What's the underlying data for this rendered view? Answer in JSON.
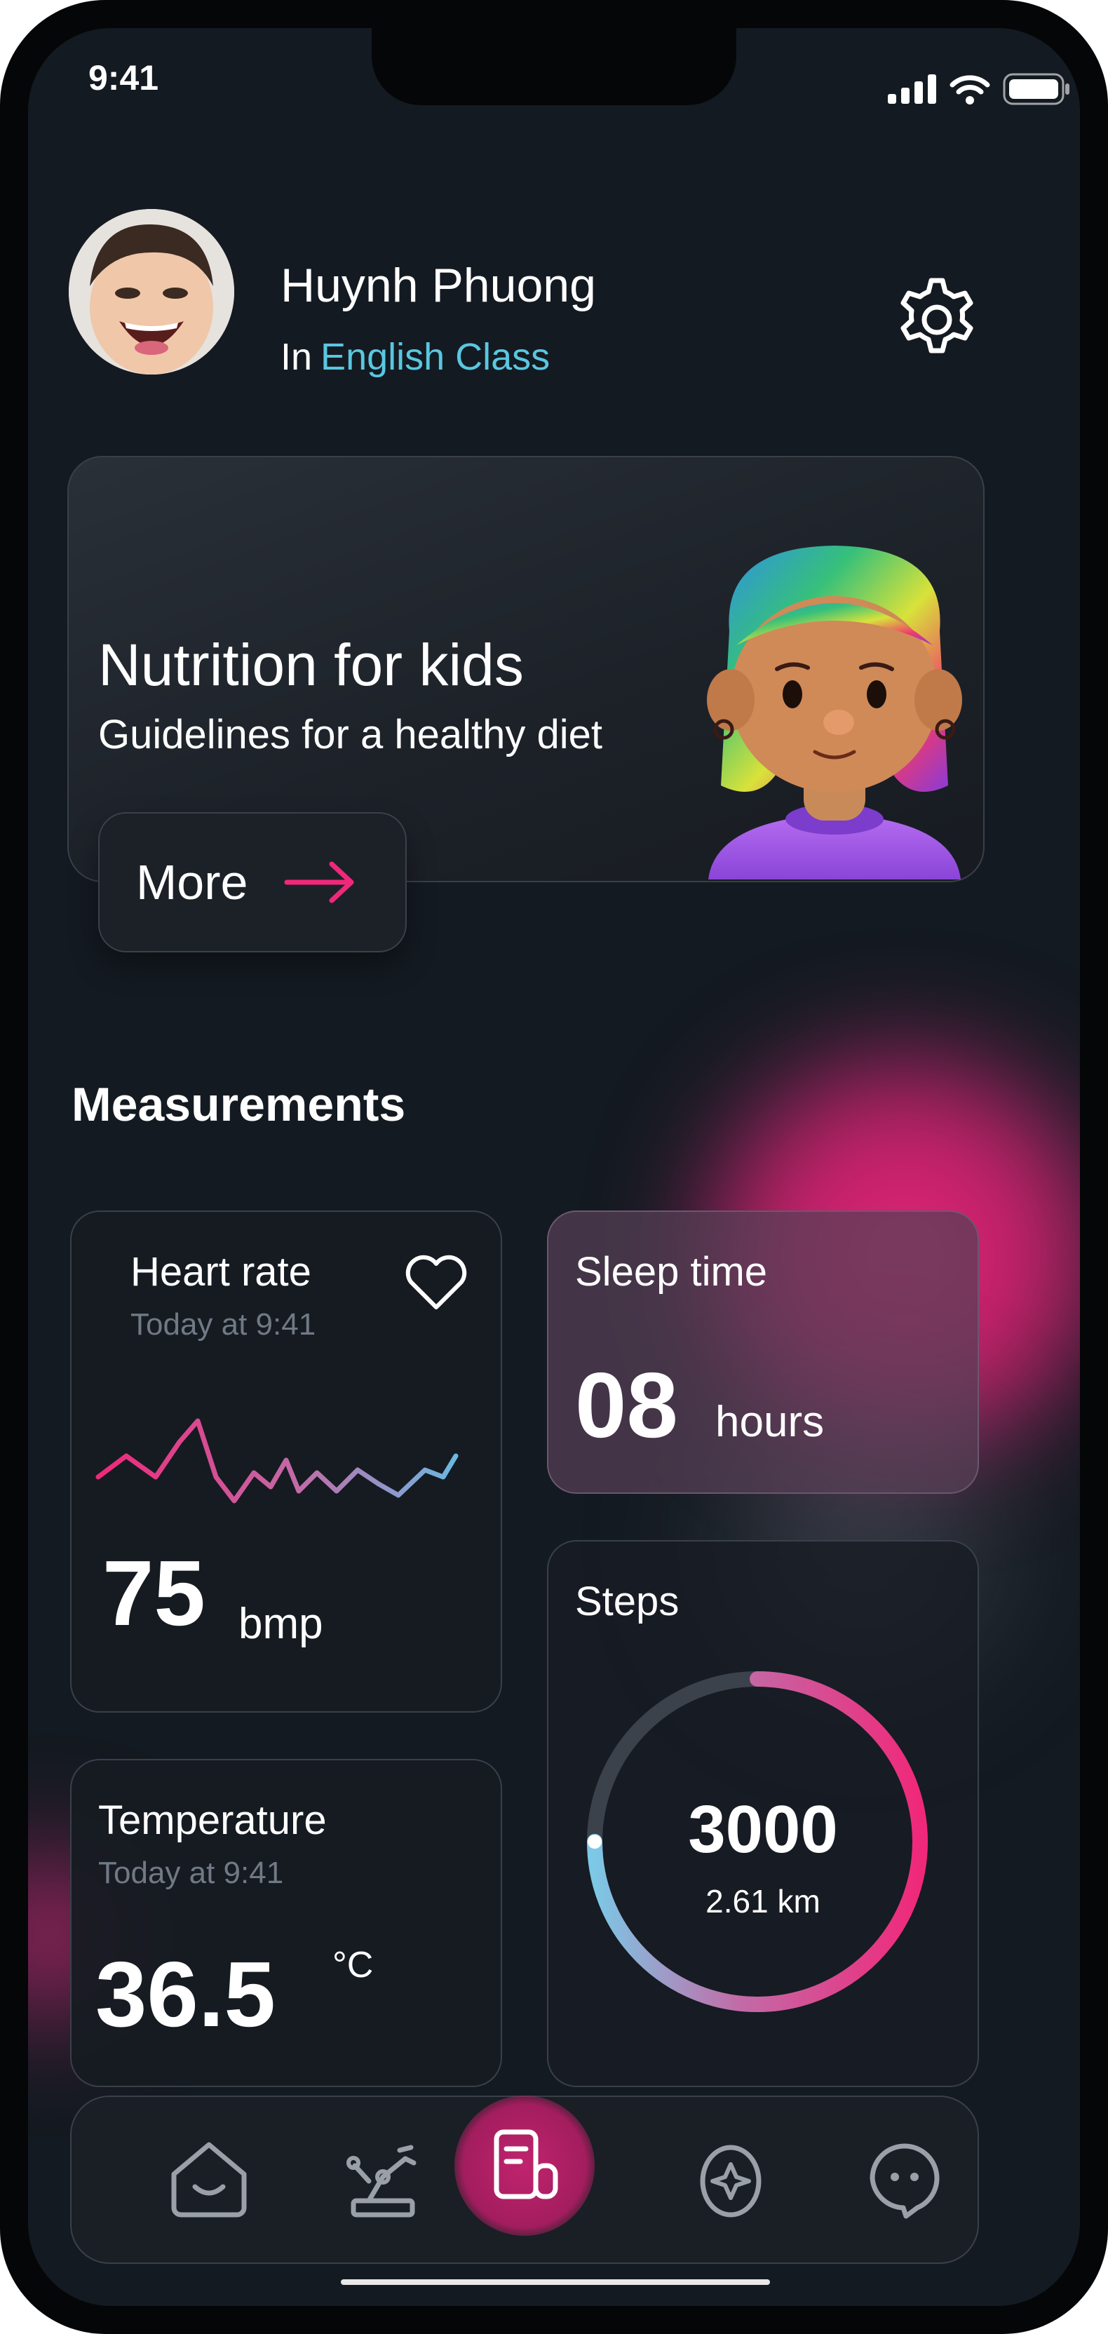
{
  "status_bar": {
    "time": "9:41"
  },
  "profile": {
    "name": "Huynh Phuong",
    "prefix": "In",
    "class_name": "English Class",
    "class_color": "#59c7e0"
  },
  "banner": {
    "title": "Nutrition for kids",
    "subtitle": "Guidelines for a healthy diet",
    "more_label": "More"
  },
  "measurements": {
    "title": "Measurements",
    "heart_rate": {
      "title": "Heart rate",
      "time": "Today at 9:41",
      "value": "75",
      "unit": "bmp"
    },
    "sleep_time": {
      "title": "Sleep time",
      "value": "08",
      "unit": "hours"
    },
    "steps": {
      "title": "Steps",
      "value": "3000",
      "distance": "2.61 km",
      "progress": 0.75
    },
    "temperature": {
      "title": "Temperature",
      "time": "Today at 9:41",
      "value": "36.5",
      "unit": "°C"
    }
  },
  "nav": {
    "items": [
      "home-icon",
      "robot-arm-icon",
      "report-icon",
      "explore-icon",
      "chat-icon"
    ],
    "active": "report-icon"
  },
  "colors": {
    "accent_pink": "#f0287a",
    "accent_cyan": "#59c7e0",
    "background": "#141a21"
  }
}
